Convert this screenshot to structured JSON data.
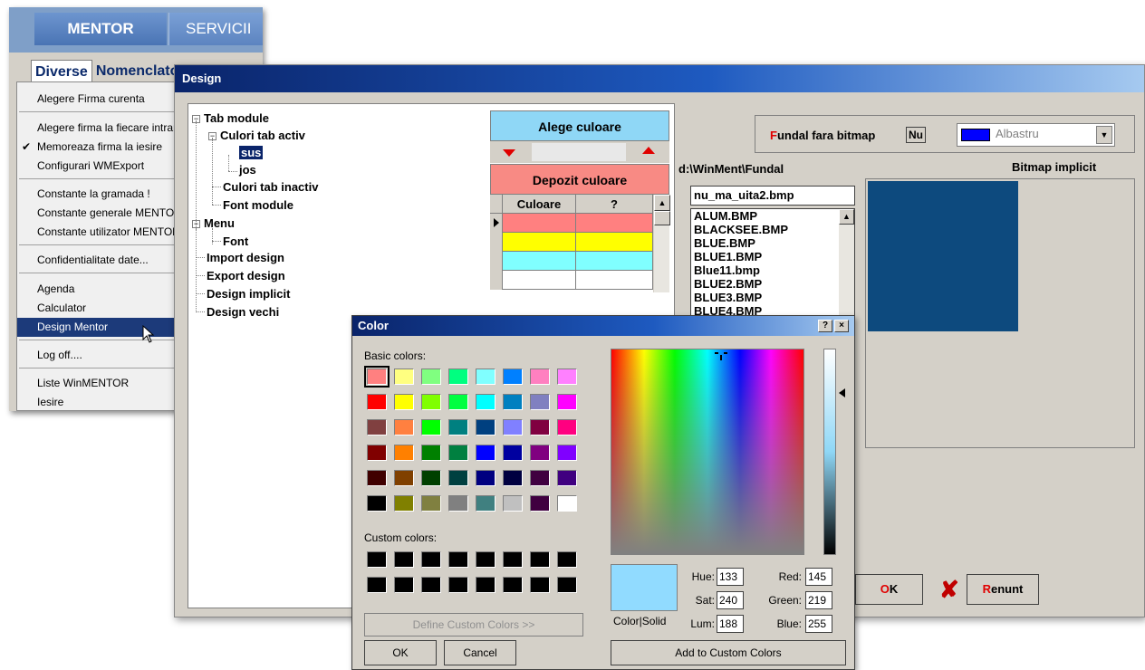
{
  "mentor": {
    "tabs": [
      "MENTOR",
      "SERVICII"
    ],
    "menubar": [
      "Diverse",
      "Nomenclatoare"
    ],
    "menu_items": [
      {
        "label": "Alegere Firma curenta"
      },
      {
        "label": "Alegere firma la fiecare intrare"
      },
      {
        "label": "Memoreaza firma la iesire",
        "checked": true
      },
      {
        "label": "Configurari WMExport"
      },
      {
        "label": "Constante la gramada !"
      },
      {
        "label": "Constante generale MENTOR"
      },
      {
        "label": "Constante utilizator MENTOR"
      },
      {
        "label": "Confidentialitate date..."
      },
      {
        "label": "Agenda"
      },
      {
        "label": "Calculator"
      },
      {
        "label": "Design Mentor",
        "selected": true
      },
      {
        "label": "Log off...."
      },
      {
        "label": "Liste WinMENTOR"
      },
      {
        "label": "Iesire"
      }
    ],
    "check_mark": "✔"
  },
  "design": {
    "title": "Design",
    "tree": {
      "tab_module": "Tab module",
      "culori_tab_activ": "Culori tab activ",
      "sus": "sus",
      "jos": "jos",
      "culori_tab_inactiv": "Culori tab inactiv",
      "font_module": "Font module",
      "menu": "Menu",
      "font": "Font",
      "import_design": "Import design",
      "export_design": "Export design",
      "design_implicit": "Design implicit",
      "design_vechi": "Design vechi"
    },
    "alege_culoare": "Alege culoare",
    "depozit_culoare": "Depozit culoare",
    "grid_headers": [
      "Culoare",
      "?"
    ],
    "grid_rows": [
      {
        "color": "#ff8080"
      },
      {
        "color": "#ffff00"
      },
      {
        "color": "#80ffff"
      },
      {
        "color": "#ffffff"
      }
    ],
    "fundal": {
      "label_first": "F",
      "label_rest": "undal fara bitmap",
      "value": "Nu",
      "color_name": "Albastru",
      "color": "#0000ff"
    },
    "path": "d:\\WinMent\\Fundal",
    "bitmap_label": "Bitmap implicit",
    "bitmap_color": "#0d4a7e",
    "file_input": "nu_ma_uita2.bmp",
    "files": [
      "ALUM.BMP",
      "BLACKSEE.BMP",
      "BLUE.BMP",
      "BLUE1.BMP",
      "Blue11.bmp",
      "BLUE2.BMP",
      "BLUE3.BMP",
      "BLUE4.BMP"
    ],
    "ok_first": "O",
    "ok_rest": "K",
    "renunt_first": "R",
    "renunt_rest": "enunt"
  },
  "color_dialog": {
    "title": "Color",
    "help_btn": "?",
    "close_btn": "×",
    "basic_colors_label": "Basic colors:",
    "custom_colors_label": "Custom colors:",
    "basic_colors": [
      [
        "#ff8080",
        "#ffff80",
        "#80ff80",
        "#00ff80",
        "#80ffff",
        "#0080ff",
        "#ff80c0",
        "#ff80ff"
      ],
      [
        "#ff0000",
        "#ffff00",
        "#80ff00",
        "#00ff40",
        "#00ffff",
        "#0080c0",
        "#8080c0",
        "#ff00ff"
      ],
      [
        "#804040",
        "#ff8040",
        "#00ff00",
        "#008080",
        "#004080",
        "#8080ff",
        "#800040",
        "#ff0080"
      ],
      [
        "#800000",
        "#ff8000",
        "#008000",
        "#008040",
        "#0000ff",
        "#0000a0",
        "#800080",
        "#8000ff"
      ],
      [
        "#400000",
        "#804000",
        "#004000",
        "#004040",
        "#000080",
        "#000040",
        "#400040",
        "#400080"
      ],
      [
        "#000000",
        "#808000",
        "#808040",
        "#808080",
        "#408080",
        "#c0c0c0",
        "#400040",
        "#ffffff"
      ]
    ],
    "custom_colors": [
      [
        "#000000",
        "#000000",
        "#000000",
        "#000000",
        "#000000",
        "#000000",
        "#000000",
        "#000000"
      ],
      [
        "#000000",
        "#000000",
        "#000000",
        "#000000",
        "#000000",
        "#000000",
        "#000000",
        "#000000"
      ]
    ],
    "define_custom": "Define Custom Colors >>",
    "ok": "OK",
    "cancel": "Cancel",
    "color_solid": "Color|Solid",
    "hue_label": "Hue:",
    "hue": "133",
    "sat_label": "Sat:",
    "sat": "240",
    "lum_label": "Lum:",
    "lum": "188",
    "red_label": "Red:",
    "red": "145",
    "green_label": "Green:",
    "green": "219",
    "blue_label": "Blue:",
    "blue": "255",
    "preview_color": "#91dbff",
    "add_custom": "Add to Custom Colors"
  }
}
